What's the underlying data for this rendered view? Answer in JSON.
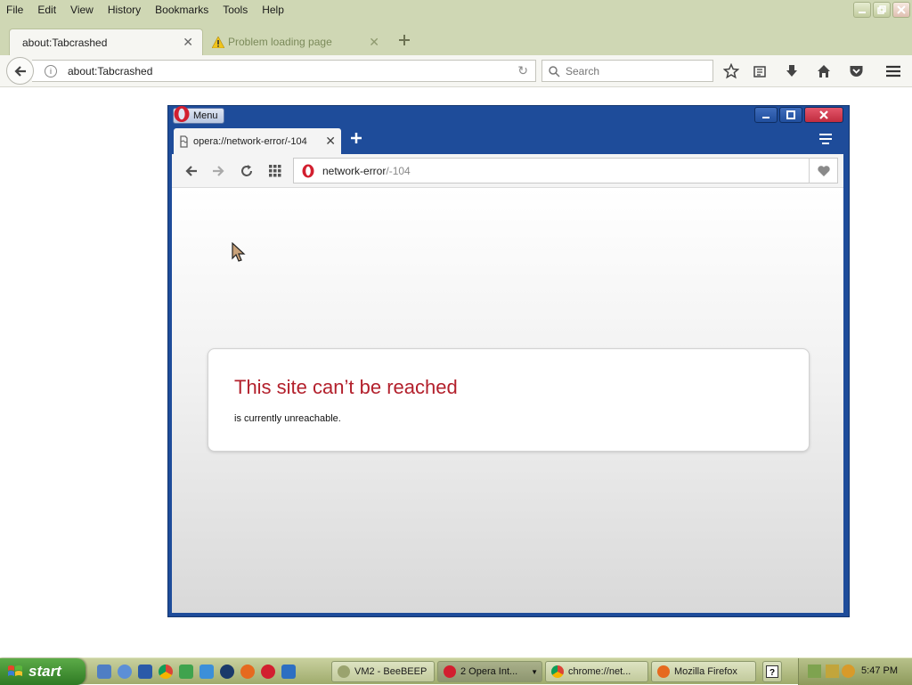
{
  "firefox": {
    "menubar": [
      "File",
      "Edit",
      "View",
      "History",
      "Bookmarks",
      "Tools",
      "Help"
    ],
    "tabs": [
      {
        "label": "about:Tabcrashed",
        "active": true
      },
      {
        "label": "Problem loading page",
        "active": false
      }
    ],
    "url": "about:Tabcrashed",
    "search_placeholder": "Search"
  },
  "opera": {
    "menu_label": "Menu",
    "tab_label": "opera://network-error/-104",
    "address_main": "network-error",
    "address_dim": "/-104",
    "error_title": "This site can’t be reached",
    "error_detail": "is currently unreachable."
  },
  "taskbar": {
    "start_label": "start",
    "tasks": [
      {
        "label": "VM2 - BeeBEEP"
      },
      {
        "label": "2 Opera Int..."
      },
      {
        "label": "chrome://net..."
      },
      {
        "label": "Mozilla Firefox"
      }
    ],
    "clock": "5:47 PM"
  },
  "colors": {
    "firefox_chrome": "#cfd7b4",
    "opera_frame": "#1e4c9a",
    "error_red": "#b3202c",
    "opera_close": "#c02c3f",
    "start_green": "#3c8c2e"
  }
}
